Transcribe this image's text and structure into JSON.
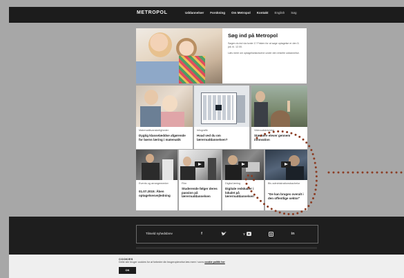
{
  "header": {
    "logo": "METROPOL",
    "nav": [
      "Uddannelser",
      "Forskning",
      "Om Metropol",
      "Kontakt",
      "English",
      "Søg"
    ]
  },
  "hero": {
    "title": "Søg ind på Metropol",
    "text1": "Søgen du ind via kvote 1? Fristen for at søge optagelse er den 5. juli, kl. 12.00.",
    "text2": "Læs mere om optagelseskravene under den enkelte uddannelse."
  },
  "tiles": [
    {
      "category": "Matematikvanskeligheder",
      "title": "Dygtig klasselæddse afgørende for børns læring i matematik"
    },
    {
      "category": "Infografik",
      "title": "Hvad ved du om lærernuddannelsen?"
    },
    {
      "category": "Videoudskrivning",
      "title": "Stærkere elever gennem innovation"
    },
    {
      "category": "Events og arrangementer",
      "title": "01.07.2015: Åben optagelsesvejledning"
    },
    {
      "category": "Film",
      "title": "Studerende følger deres passion på lærernuddannelsen"
    },
    {
      "category": "Digital læring",
      "title": "Digitale redskaber i lokalet på lærernuddannelsen"
    },
    {
      "category": "Blv administrationsbachelor",
      "title": "\"De kan bruges overalt i den offentlige sektor\""
    }
  ],
  "footer": {
    "newsletter": "Tilmeld nyhedsbrev",
    "social_icons": [
      "facebook-icon",
      "twitter-icon",
      "youtube-icon",
      "instagram-icon",
      "linkedin-icon"
    ],
    "social_glyphs": [
      "f",
      "🐦",
      "You",
      "◘",
      "in"
    ]
  },
  "cookie": {
    "title": "COOKIES",
    "text": "Dette site bruger cookies for at forbedre din brugeroplevelse læs mere i vores",
    "link": "cookie politik her",
    "button": "OK"
  },
  "colors": {
    "background": "#a7a7a7",
    "dark": "#1c1c1c",
    "annotation": "#8b3d24"
  }
}
